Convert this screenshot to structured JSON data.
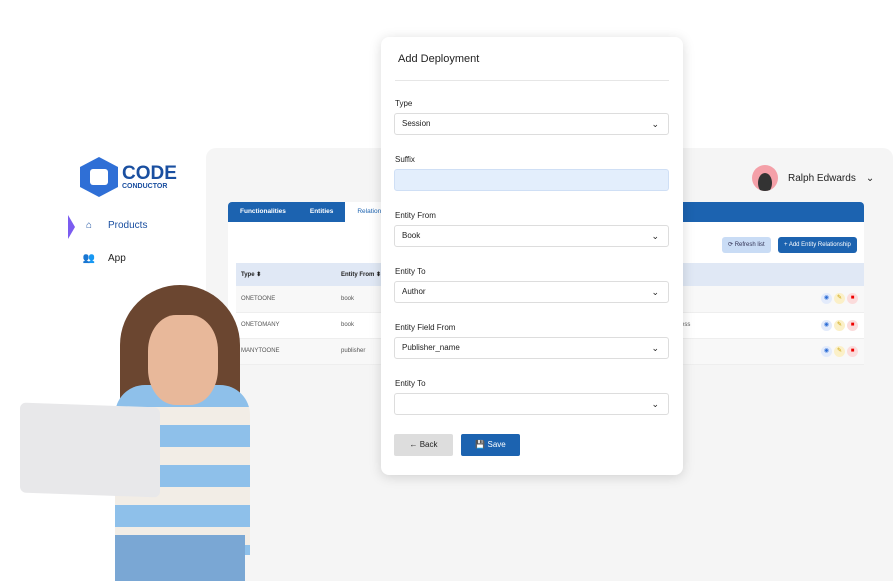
{
  "brand": {
    "line1": "CODE",
    "line2": "CONDUCTOR"
  },
  "sidebar": {
    "items": [
      {
        "label": "Products",
        "icon": "home-icon"
      },
      {
        "label": "App",
        "icon": "users-icon"
      }
    ]
  },
  "user": {
    "name": "Ralph Edwards"
  },
  "tabs": [
    "Functionalities",
    "Entities",
    "Relation"
  ],
  "toolbar": {
    "refresh": "⟳ Refresh list",
    "add": "+ Add Entity Relationship"
  },
  "table": {
    "headers": [
      "Type ⬍",
      "Entity From ⬍"
    ],
    "rows": [
      [
        "ONETOONE",
        "book",
        ""
      ],
      [
        "ONETOMANY",
        "book",
        "ess"
      ],
      [
        "MANYTOONE",
        "publisher",
        ""
      ]
    ]
  },
  "modal": {
    "title": "Add Deployment",
    "fields": [
      {
        "label": "Type",
        "value": "Session"
      },
      {
        "label": "Suffix",
        "value": ""
      },
      {
        "label": "Entity From",
        "value": "Book"
      },
      {
        "label": "Entity To",
        "value": "Author"
      },
      {
        "label": "Entity Field From",
        "value": "Publisher_name"
      },
      {
        "label": "Entity To",
        "value": ""
      }
    ],
    "back": "Back",
    "save": "Save"
  },
  "colors": {
    "primary": "#1c63b0",
    "accent": "#7b5cf0"
  }
}
